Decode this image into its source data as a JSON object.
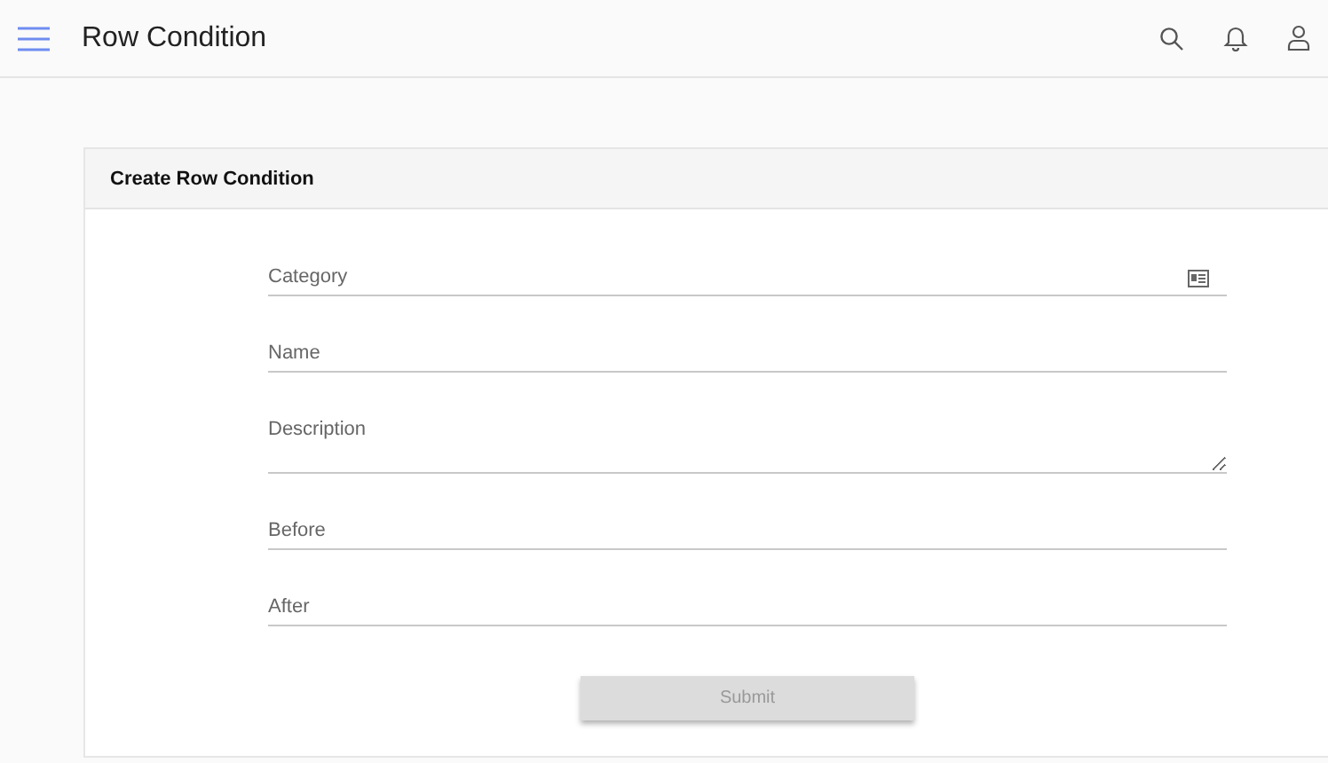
{
  "app_bar": {
    "title": "Row Condition"
  },
  "form": {
    "title": "Create Row Condition",
    "fields": [
      {
        "kind": "select",
        "placeholder": "Category"
      },
      {
        "kind": "text",
        "placeholder": "Name"
      },
      {
        "kind": "textarea",
        "placeholder": "Description"
      },
      {
        "kind": "text",
        "placeholder": "Before"
      },
      {
        "kind": "text",
        "placeholder": "After"
      }
    ],
    "submit": {
      "label": "Submit",
      "disabled": true
    }
  }
}
